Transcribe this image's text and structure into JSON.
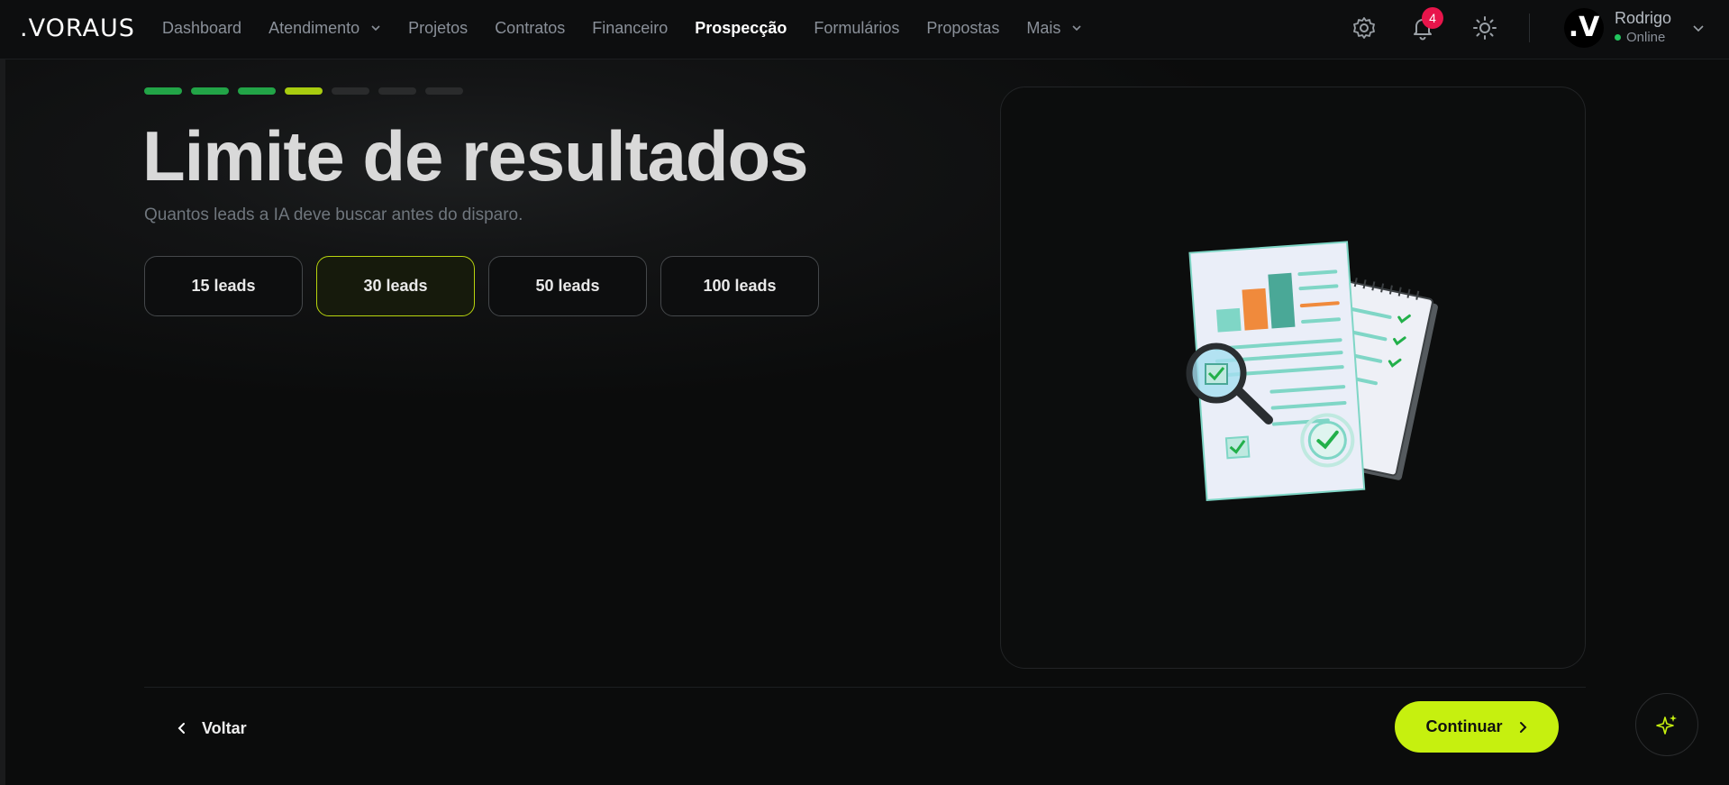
{
  "header": {
    "logo": ".VORAUS",
    "nav": [
      {
        "label": "Dashboard",
        "dropdown": false,
        "active": false
      },
      {
        "label": "Atendimento",
        "dropdown": true,
        "active": false
      },
      {
        "label": "Projetos",
        "dropdown": false,
        "active": false
      },
      {
        "label": "Contratos",
        "dropdown": false,
        "active": false
      },
      {
        "label": "Financeiro",
        "dropdown": false,
        "active": false
      },
      {
        "label": "Prospecção",
        "dropdown": false,
        "active": true
      },
      {
        "label": "Formulários",
        "dropdown": false,
        "active": false
      },
      {
        "label": "Propostas",
        "dropdown": false,
        "active": false
      },
      {
        "label": "Mais",
        "dropdown": true,
        "active": false
      }
    ],
    "notifications_count": "4",
    "user": {
      "avatar_text": ".V",
      "name": "Rodrigo",
      "status": "Online"
    }
  },
  "wizard": {
    "steps_total": 7,
    "steps_done": 3,
    "current_step": 4,
    "title": "Limite de resultados",
    "subtitle": "Quantos leads a IA deve buscar antes do disparo.",
    "options": [
      "15 leads",
      "30 leads",
      "50 leads",
      "100 leads"
    ],
    "selected_option": "30 leads"
  },
  "footer": {
    "back_label": "Voltar",
    "continue_label": "Continuar"
  },
  "colors": {
    "accent": "#c6f00f",
    "step_done": "#22a447",
    "step_current": "#a8cc0f",
    "badge": "#e8154b"
  },
  "icons": [
    "gear-icon",
    "bell-icon",
    "sun-icon",
    "chevron-down-icon",
    "chevron-left-icon",
    "chevron-right-icon",
    "sparkle-icon"
  ]
}
